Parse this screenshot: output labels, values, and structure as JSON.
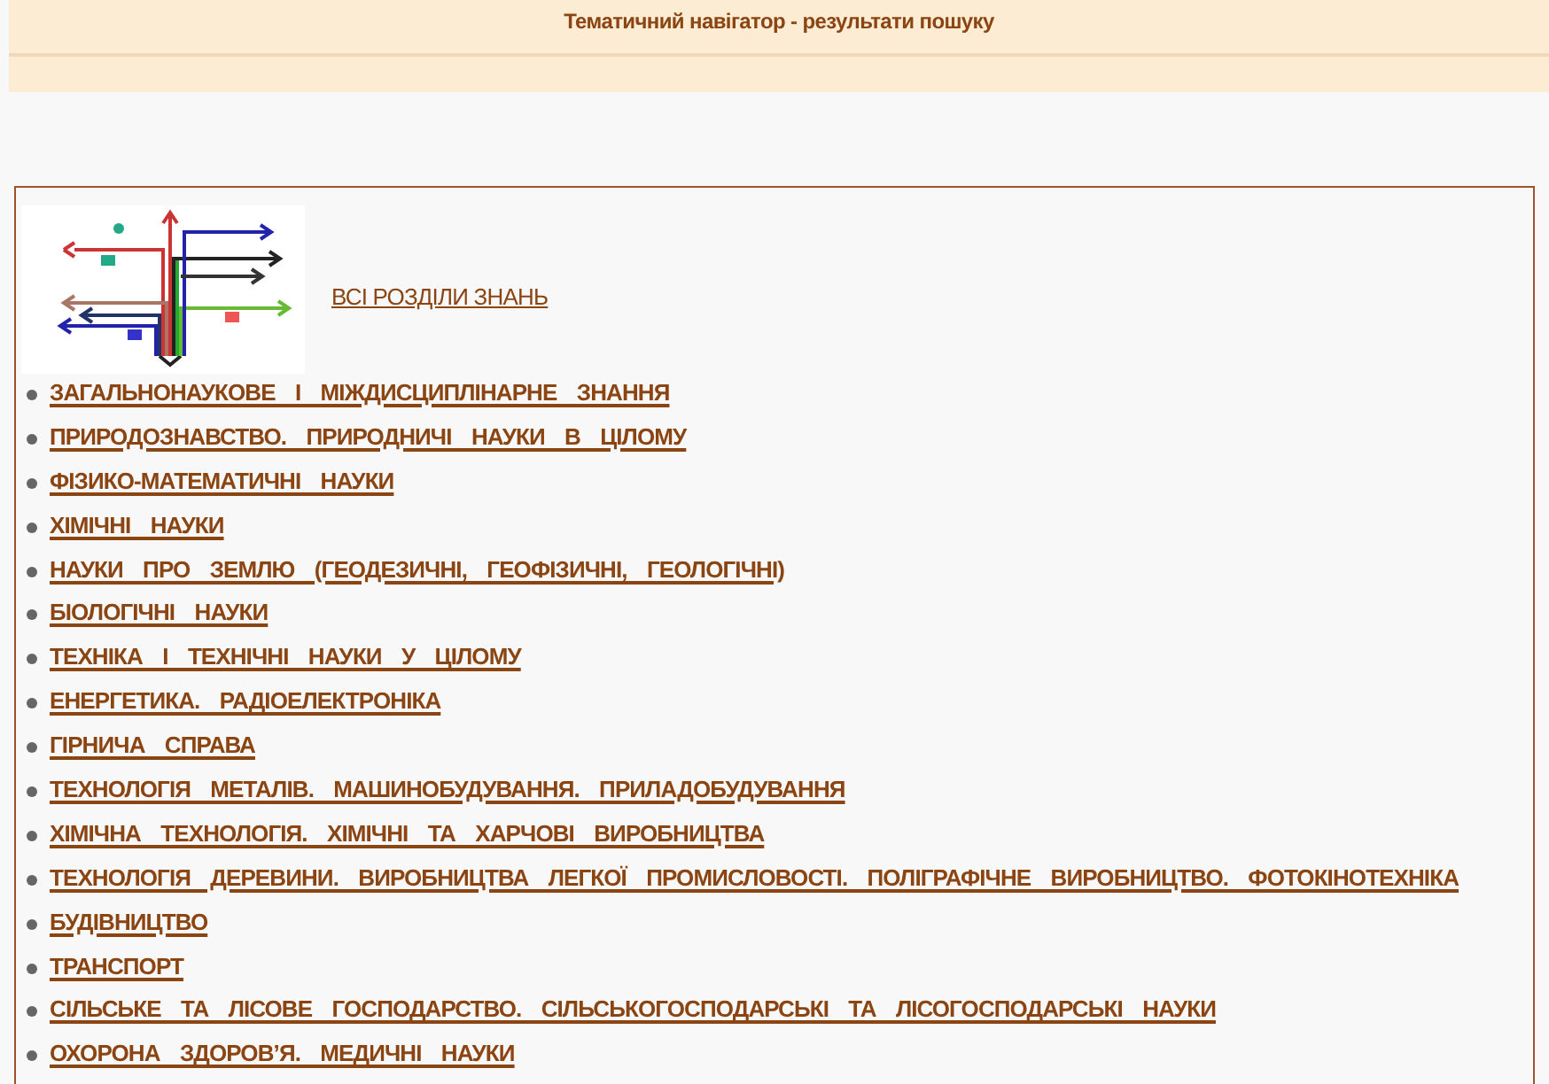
{
  "header": {
    "title": "Тематичний навігатор - результати пошуку"
  },
  "all_sections_link": "ВСІ РОЗДІЛИ ЗНАНЬ",
  "sections": [
    "ЗАГАЛЬНОНАУКОВЕ І МІЖДИСЦИПЛІНАРНЕ ЗНАННЯ",
    "ПРИРОДОЗНАВСТВО. ПРИРОДНИЧІ НАУКИ В ЦІЛОМУ",
    "ФІЗИКО-МАТЕМАТИЧНІ НАУКИ",
    "ХІМІЧНІ НАУКИ",
    "НАУКИ ПРО ЗЕМЛЮ (ГЕОДЕЗИЧНІ, ГЕОФІЗИЧНІ, ГЕОЛОГІЧНІ)",
    "БІОЛОГІЧНІ НАУКИ",
    "ТЕХНІКА І ТЕХНІЧНІ НАУКИ У ЦІЛОМУ",
    "ЕНЕРГЕТИКА. РАДІОЕЛЕКТРОНІКА",
    "ГІРНИЧА СПРАВА",
    "ТЕХНОЛОГІЯ МЕТАЛІВ. МАШИНОБУДУВАННЯ. ПРИЛАДОБУДУВАННЯ",
    "ХІМІЧНА ТЕХНОЛОГІЯ. ХІМІЧНІ ТА ХАРЧОВІ ВИРОБНИЦТВА",
    "ТЕХНОЛОГІЯ ДЕРЕВИНИ. ВИРОБНИЦТВА ЛЕГКОЇ ПРОМИСЛОВОСТІ. ПОЛІГРАФІЧНЕ ВИРОБНИЦТВО. ФОТОКІНОТЕХНІКА",
    "БУДІВНИЦТВО",
    "ТРАНСПОРТ",
    "СІЛЬСЬКЕ ТА ЛІСОВЕ ГОСПОДАРСТВО. СІЛЬСЬКОГОСПОДАРСЬКІ ТА ЛІСОГОСПОДАРСЬКІ НАУКИ",
    "ОХОРОНА ЗДОРОВ’Я. МЕДИЧНІ НАУКИ"
  ]
}
